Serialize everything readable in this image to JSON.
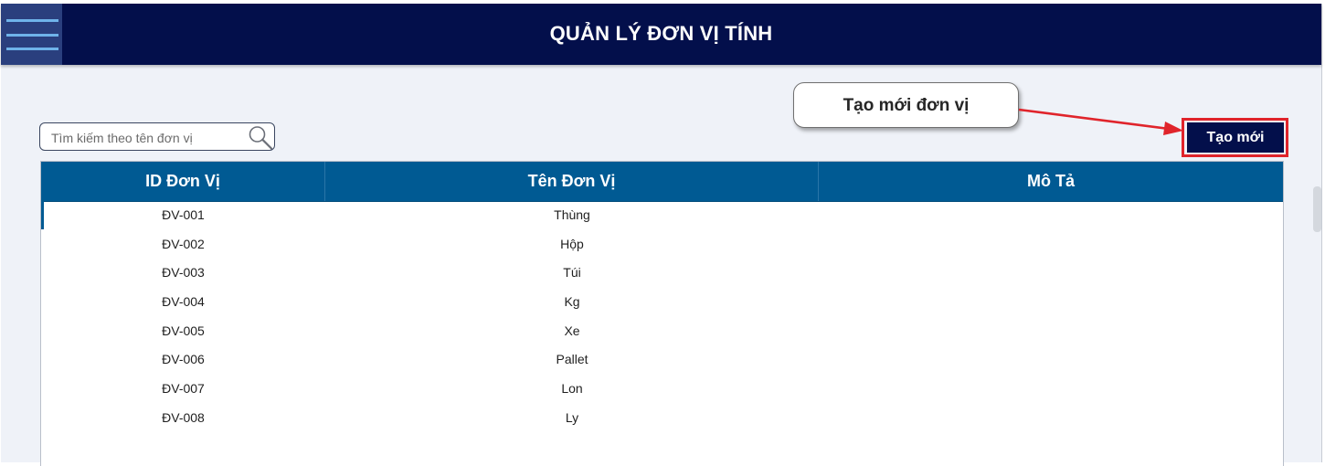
{
  "header": {
    "title": "QUẢN LÝ ĐƠN VỊ TÍNH",
    "menu_icon": "hamburger-menu-icon",
    "background": "#030f4b"
  },
  "search": {
    "placeholder": "Tìm kiếm theo tên đơn vị",
    "value": "",
    "icon": "search-icon"
  },
  "callout": {
    "text": "Tạo mới đơn vị",
    "arrow_color": "#e0242b"
  },
  "toolbar": {
    "new_label": "Tạo mới"
  },
  "table": {
    "header_color": "#005a93",
    "columns": [
      "ID Đơn Vị",
      "Tên Đơn Vị",
      "Mô Tả"
    ],
    "rows": [
      {
        "id": "ĐV-001",
        "name": "Thùng",
        "desc": ""
      },
      {
        "id": "ĐV-002",
        "name": "Hộp",
        "desc": ""
      },
      {
        "id": "ĐV-003",
        "name": "Túi",
        "desc": ""
      },
      {
        "id": "ĐV-004",
        "name": "Kg",
        "desc": ""
      },
      {
        "id": "ĐV-005",
        "name": "Xe",
        "desc": ""
      },
      {
        "id": "ĐV-006",
        "name": "Pallet",
        "desc": ""
      },
      {
        "id": "ĐV-007",
        "name": "Lon",
        "desc": ""
      },
      {
        "id": "ĐV-008",
        "name": "Ly",
        "desc": ""
      }
    ]
  }
}
